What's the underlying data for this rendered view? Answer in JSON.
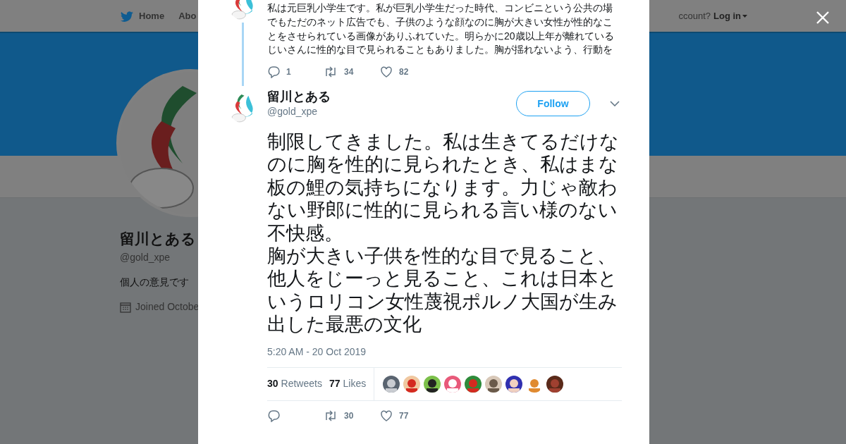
{
  "background_page": {
    "nav_items": [
      {
        "label": "Home",
        "kind": "home"
      },
      {
        "label": "Abo",
        "kind": "plain"
      }
    ],
    "login_prompt": "ccount?",
    "login_link": "Log in",
    "profile": {
      "name": "留川とある",
      "handle": "@gold_xpe",
      "bio": "個人の意見です",
      "joined": "Joined Octobe"
    }
  },
  "thread_tweet": {
    "text": "私は元巨乳小学生です。私が巨乳小学生だった時代、コンビニという公共の場でもただのネット広告でも、子供のような顔なのに胸が大きい女性が性的なことをさせられている画像がありふれていた。明らかに20歳以上年が離れているじいさんに性的な目で見られることもありました。胸が揺れないよう、行動を",
    "actions": [
      {
        "kind": "reply",
        "count": "1"
      },
      {
        "kind": "retweet",
        "count": "34"
      },
      {
        "kind": "like",
        "count": "82"
      }
    ]
  },
  "tweet": {
    "name": "留川とある",
    "handle": "@gold_xpe",
    "follow_button": "Follow",
    "paragraphs": [
      "制限してきました。私は生きてるだけなのに胸を性的に見られたとき、私はまな板の鯉の気持ちになります。力じゃ敵わない野郎に性的に見られる言い様のない不快感。",
      "胸が大きい子供を性的な目で見ること、他人をじーっと見ること、これは日本というロリコン女性蔑視ポルノ大国が生み出した最悪の文化"
    ],
    "timestamp": "5:20 AM - 20 Oct 2019",
    "stats": [
      {
        "count": "30",
        "label": "Retweets"
      },
      {
        "count": "77",
        "label": "Likes"
      }
    ],
    "liker_avatars": [
      {
        "kind": "picture"
      },
      {
        "kind": "picture"
      },
      {
        "kind": "picture"
      },
      {
        "kind": "picture"
      },
      {
        "kind": "picture"
      },
      {
        "kind": "picture"
      },
      {
        "kind": "picture"
      },
      {
        "kind": "picture"
      },
      {
        "kind": "picture"
      }
    ],
    "actions": [
      {
        "kind": "reply"
      },
      {
        "kind": "retweet",
        "count": "30"
      },
      {
        "kind": "like",
        "count": "77"
      }
    ]
  }
}
